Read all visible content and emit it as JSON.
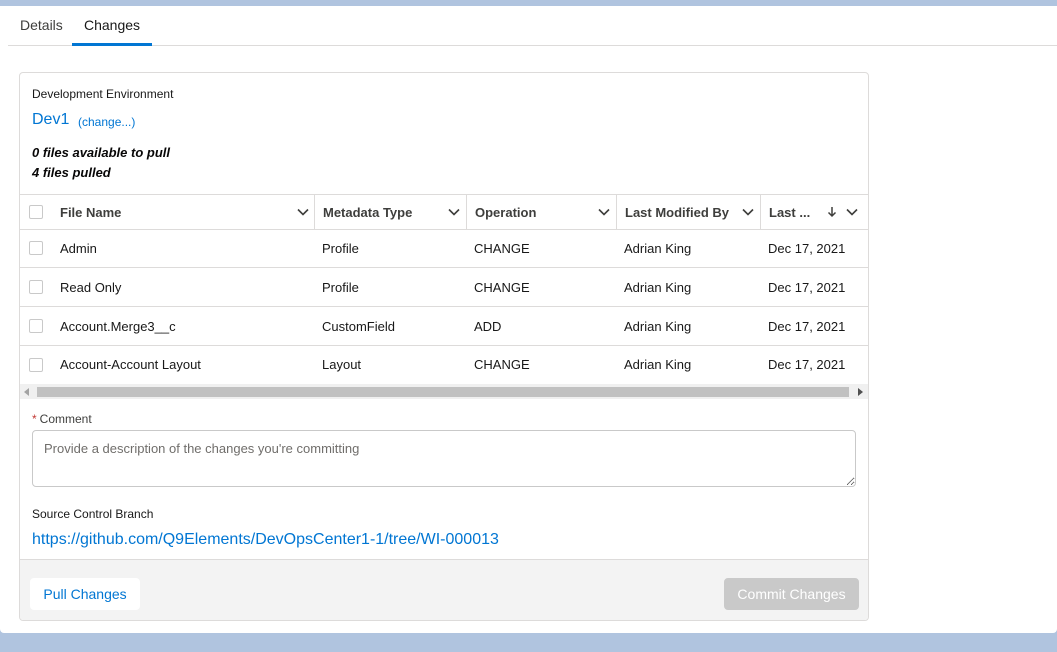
{
  "tabs": [
    {
      "label": "Details"
    },
    {
      "label": "Changes"
    }
  ],
  "environment": {
    "label": "Development Environment",
    "value": "Dev1",
    "change_link": "(change...)",
    "files_available": "0 files available to pull",
    "files_pulled": "4 files pulled"
  },
  "table": {
    "columns": [
      {
        "label": "File Name"
      },
      {
        "label": "Metadata Type"
      },
      {
        "label": "Operation"
      },
      {
        "label": "Last Modified By"
      },
      {
        "label": "Last ..."
      }
    ],
    "rows": [
      {
        "file": "Admin",
        "type": "Profile",
        "op": "CHANGE",
        "by": "Adrian King",
        "date": "Dec 17, 2021"
      },
      {
        "file": "Read Only",
        "type": "Profile",
        "op": "CHANGE",
        "by": "Adrian King",
        "date": "Dec 17, 2021"
      },
      {
        "file": "Account.Merge3__c",
        "type": "CustomField",
        "op": "ADD",
        "by": "Adrian King",
        "date": "Dec 17, 2021"
      },
      {
        "file": "Account-Account Layout",
        "type": "Layout",
        "op": "CHANGE",
        "by": "Adrian King",
        "date": "Dec 17, 2021"
      }
    ]
  },
  "comment": {
    "required_marker": "*",
    "label": "Comment",
    "placeholder": "Provide a description of the changes you're committing"
  },
  "branch": {
    "label": "Source Control Branch",
    "url": "https://github.com/Q9Elements/DevOpsCenter1-1/tree/WI-000013"
  },
  "footer": {
    "pull_label": "Pull Changes",
    "commit_label": "Commit Changes"
  },
  "colors": {
    "brand": "#0176d3",
    "disabled_button": "#c9c9c9",
    "background": "#b0c4df"
  }
}
